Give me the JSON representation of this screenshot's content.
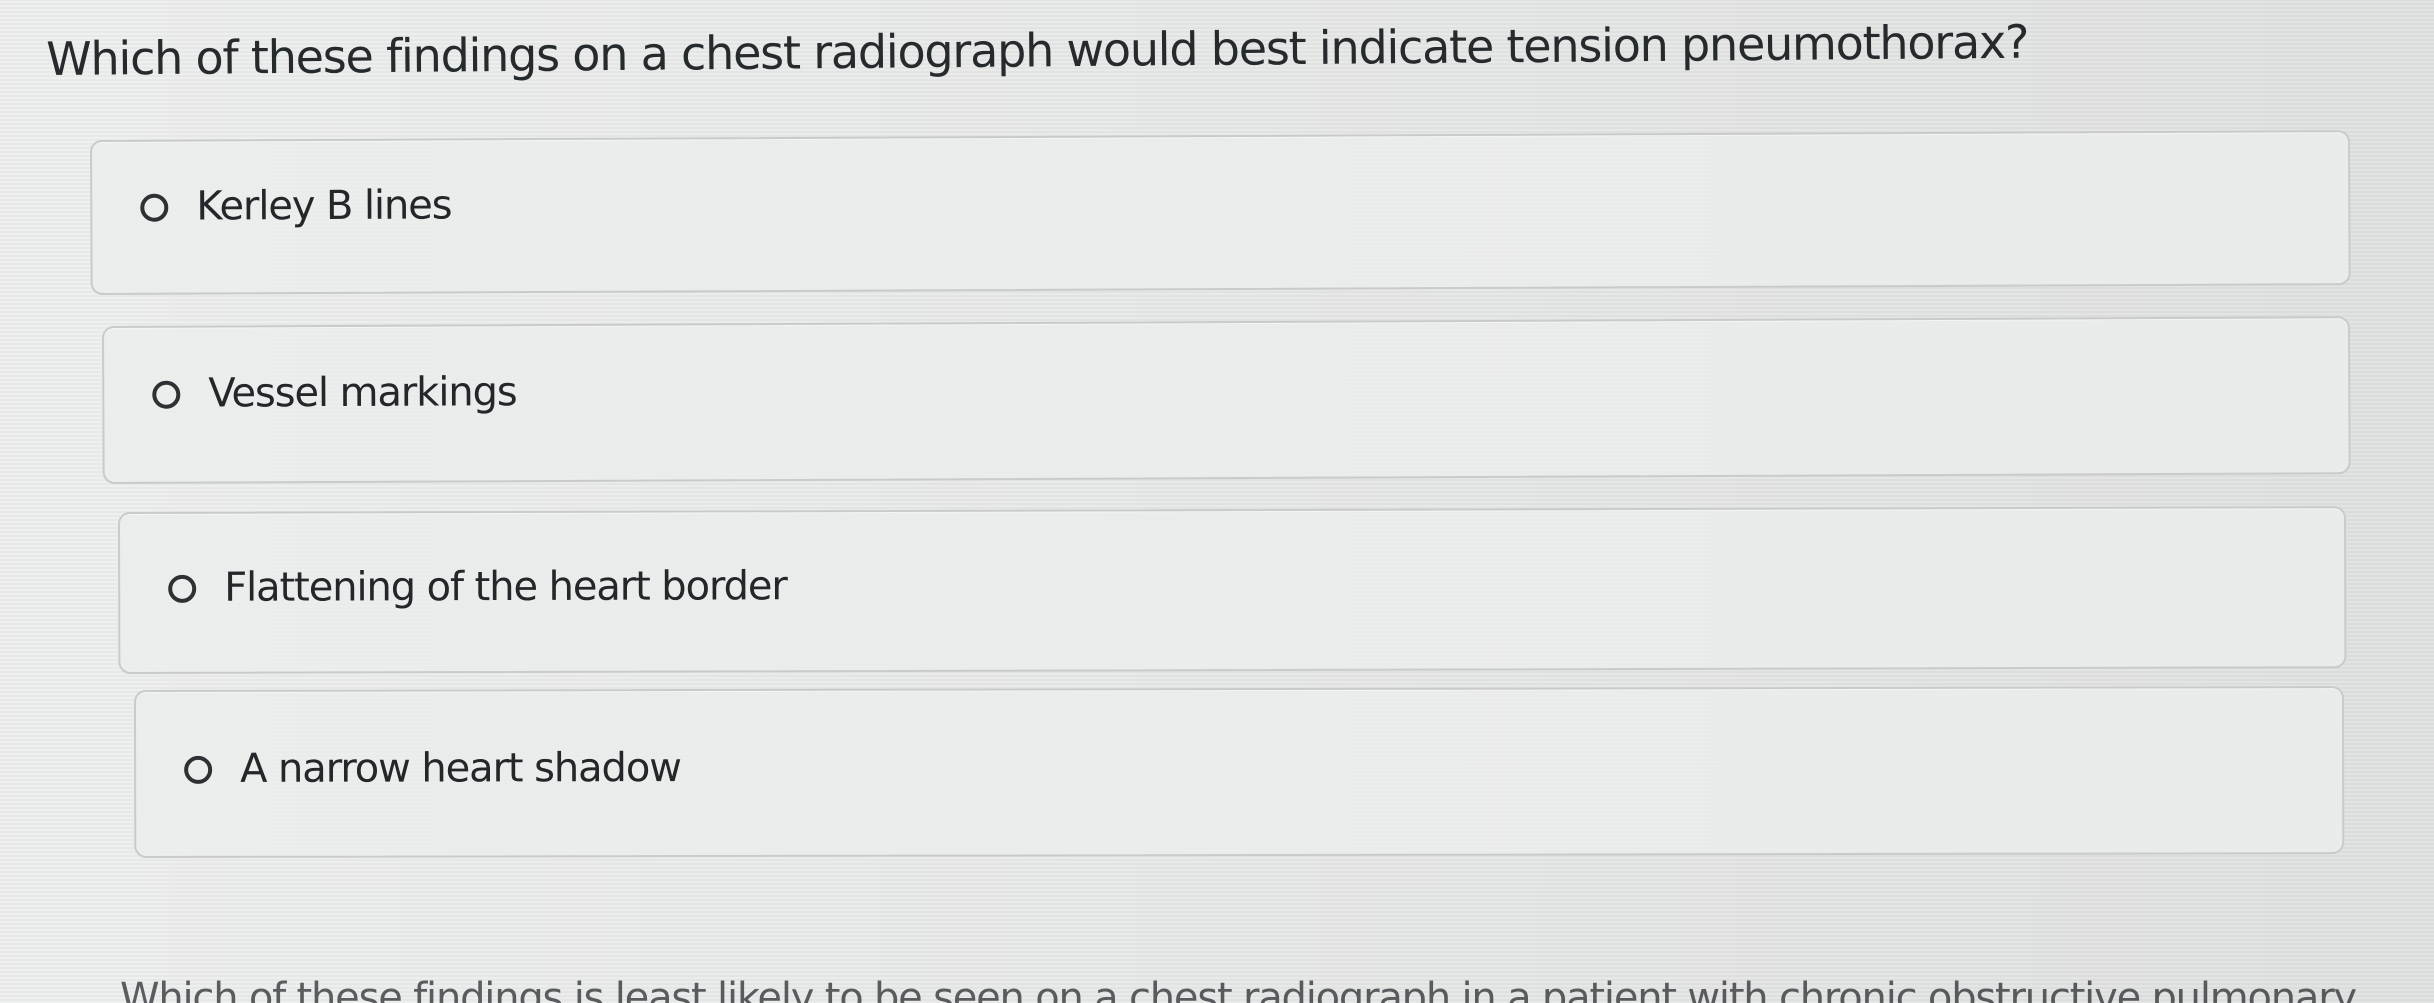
{
  "question": {
    "text": "Which of these findings on a chest radiograph would best indicate tension pneumothorax?"
  },
  "options": [
    {
      "label": "Kerley B lines",
      "selected": false
    },
    {
      "label": "Vessel markings",
      "selected": false
    },
    {
      "label": "Flattening of the heart border",
      "selected": false
    },
    {
      "label": "A narrow heart shadow",
      "selected": false
    }
  ],
  "next_question_partial": {
    "text": "Which of these findings is least likely to be seen on a chest radiograph in a patient with chronic obstructive pulmonary"
  },
  "colors": {
    "background": "#e6e7e7",
    "card_border": "#c9cbcb",
    "text": "#23272a"
  }
}
